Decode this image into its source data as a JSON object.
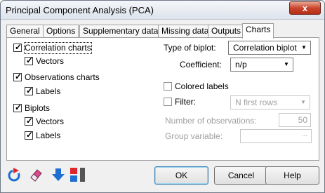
{
  "window": {
    "title": "Principal Component Analysis (PCA)",
    "close_symbol": "x"
  },
  "tabs": [
    {
      "label": "General"
    },
    {
      "label": "Options"
    },
    {
      "label": "Supplementary data"
    },
    {
      "label": "Missing data"
    },
    {
      "label": "Outputs"
    },
    {
      "label": "Charts",
      "active": true
    }
  ],
  "left_options": {
    "correlation_charts": {
      "label": "Correlation charts",
      "checked": true
    },
    "corr_vectors": {
      "label": "Vectors",
      "checked": true
    },
    "observations_charts": {
      "label": "Observations charts",
      "checked": true
    },
    "obs_labels": {
      "label": "Labels",
      "checked": true
    },
    "biplots": {
      "label": "Biplots",
      "checked": true
    },
    "biplot_vectors": {
      "label": "Vectors",
      "checked": true
    },
    "biplot_labels": {
      "label": "Labels",
      "checked": true
    }
  },
  "right_options": {
    "type_of_biplot_label": "Type of biplot:",
    "type_of_biplot_value": "Correlation biplot",
    "coefficient_label": "Coefficient:",
    "coefficient_value": "n/p",
    "colored_labels": {
      "label": "Colored labels",
      "checked": false
    },
    "filter": {
      "label": "Filter:",
      "checked": false
    },
    "filter_value": "N first rows",
    "number_of_observations_label": "Number of observations:",
    "number_of_observations_value": "50",
    "group_variable_label": "Group variable:",
    "group_variable_button": "..."
  },
  "buttons": {
    "ok": "OK",
    "cancel": "Cancel",
    "help": "Help"
  },
  "icons": {
    "reset": "reset-icon",
    "eraser": "eraser-icon",
    "download": "download-arrow-icon",
    "toggle": "toggle-icon"
  },
  "colors": {
    "accent_blue": "#1f6fd1",
    "accent_red": "#e0262b",
    "close_red": "#c9442c"
  }
}
